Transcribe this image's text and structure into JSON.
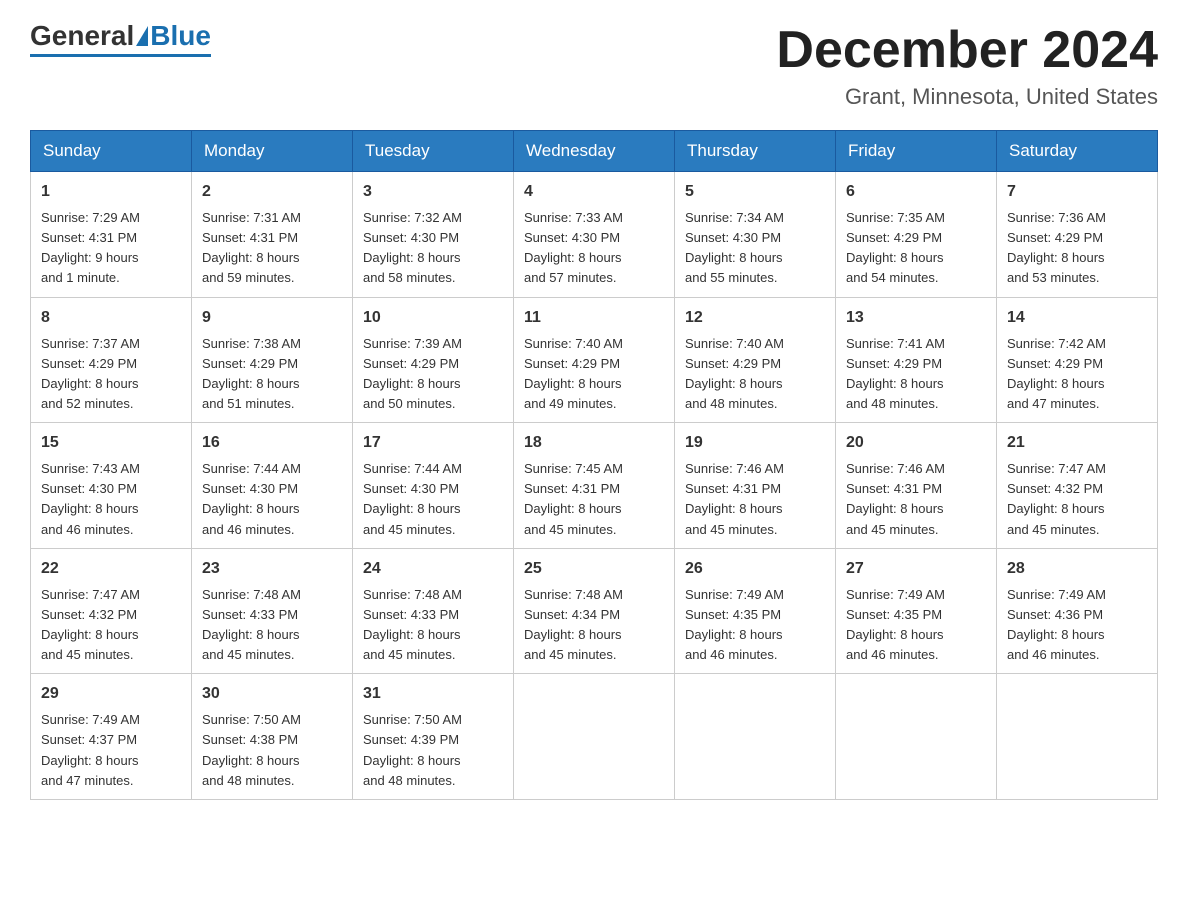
{
  "header": {
    "logo_general": "General",
    "logo_blue": "Blue",
    "month_title": "December 2024",
    "location": "Grant, Minnesota, United States"
  },
  "days_of_week": [
    "Sunday",
    "Monday",
    "Tuesday",
    "Wednesday",
    "Thursday",
    "Friday",
    "Saturday"
  ],
  "weeks": [
    [
      {
        "day": "1",
        "sunrise": "7:29 AM",
        "sunset": "4:31 PM",
        "daylight": "9 hours and 1 minute."
      },
      {
        "day": "2",
        "sunrise": "7:31 AM",
        "sunset": "4:31 PM",
        "daylight": "8 hours and 59 minutes."
      },
      {
        "day": "3",
        "sunrise": "7:32 AM",
        "sunset": "4:30 PM",
        "daylight": "8 hours and 58 minutes."
      },
      {
        "day": "4",
        "sunrise": "7:33 AM",
        "sunset": "4:30 PM",
        "daylight": "8 hours and 57 minutes."
      },
      {
        "day": "5",
        "sunrise": "7:34 AM",
        "sunset": "4:30 PM",
        "daylight": "8 hours and 55 minutes."
      },
      {
        "day": "6",
        "sunrise": "7:35 AM",
        "sunset": "4:29 PM",
        "daylight": "8 hours and 54 minutes."
      },
      {
        "day": "7",
        "sunrise": "7:36 AM",
        "sunset": "4:29 PM",
        "daylight": "8 hours and 53 minutes."
      }
    ],
    [
      {
        "day": "8",
        "sunrise": "7:37 AM",
        "sunset": "4:29 PM",
        "daylight": "8 hours and 52 minutes."
      },
      {
        "day": "9",
        "sunrise": "7:38 AM",
        "sunset": "4:29 PM",
        "daylight": "8 hours and 51 minutes."
      },
      {
        "day": "10",
        "sunrise": "7:39 AM",
        "sunset": "4:29 PM",
        "daylight": "8 hours and 50 minutes."
      },
      {
        "day": "11",
        "sunrise": "7:40 AM",
        "sunset": "4:29 PM",
        "daylight": "8 hours and 49 minutes."
      },
      {
        "day": "12",
        "sunrise": "7:40 AM",
        "sunset": "4:29 PM",
        "daylight": "8 hours and 48 minutes."
      },
      {
        "day": "13",
        "sunrise": "7:41 AM",
        "sunset": "4:29 PM",
        "daylight": "8 hours and 48 minutes."
      },
      {
        "day": "14",
        "sunrise": "7:42 AM",
        "sunset": "4:29 PM",
        "daylight": "8 hours and 47 minutes."
      }
    ],
    [
      {
        "day": "15",
        "sunrise": "7:43 AM",
        "sunset": "4:30 PM",
        "daylight": "8 hours and 46 minutes."
      },
      {
        "day": "16",
        "sunrise": "7:44 AM",
        "sunset": "4:30 PM",
        "daylight": "8 hours and 46 minutes."
      },
      {
        "day": "17",
        "sunrise": "7:44 AM",
        "sunset": "4:30 PM",
        "daylight": "8 hours and 45 minutes."
      },
      {
        "day": "18",
        "sunrise": "7:45 AM",
        "sunset": "4:31 PM",
        "daylight": "8 hours and 45 minutes."
      },
      {
        "day": "19",
        "sunrise": "7:46 AM",
        "sunset": "4:31 PM",
        "daylight": "8 hours and 45 minutes."
      },
      {
        "day": "20",
        "sunrise": "7:46 AM",
        "sunset": "4:31 PM",
        "daylight": "8 hours and 45 minutes."
      },
      {
        "day": "21",
        "sunrise": "7:47 AM",
        "sunset": "4:32 PM",
        "daylight": "8 hours and 45 minutes."
      }
    ],
    [
      {
        "day": "22",
        "sunrise": "7:47 AM",
        "sunset": "4:32 PM",
        "daylight": "8 hours and 45 minutes."
      },
      {
        "day": "23",
        "sunrise": "7:48 AM",
        "sunset": "4:33 PM",
        "daylight": "8 hours and 45 minutes."
      },
      {
        "day": "24",
        "sunrise": "7:48 AM",
        "sunset": "4:33 PM",
        "daylight": "8 hours and 45 minutes."
      },
      {
        "day": "25",
        "sunrise": "7:48 AM",
        "sunset": "4:34 PM",
        "daylight": "8 hours and 45 minutes."
      },
      {
        "day": "26",
        "sunrise": "7:49 AM",
        "sunset": "4:35 PM",
        "daylight": "8 hours and 46 minutes."
      },
      {
        "day": "27",
        "sunrise": "7:49 AM",
        "sunset": "4:35 PM",
        "daylight": "8 hours and 46 minutes."
      },
      {
        "day": "28",
        "sunrise": "7:49 AM",
        "sunset": "4:36 PM",
        "daylight": "8 hours and 46 minutes."
      }
    ],
    [
      {
        "day": "29",
        "sunrise": "7:49 AM",
        "sunset": "4:37 PM",
        "daylight": "8 hours and 47 minutes."
      },
      {
        "day": "30",
        "sunrise": "7:50 AM",
        "sunset": "4:38 PM",
        "daylight": "8 hours and 48 minutes."
      },
      {
        "day": "31",
        "sunrise": "7:50 AM",
        "sunset": "4:39 PM",
        "daylight": "8 hours and 48 minutes."
      },
      null,
      null,
      null,
      null
    ]
  ],
  "labels": {
    "sunrise": "Sunrise:",
    "sunset": "Sunset:",
    "daylight": "Daylight:"
  }
}
